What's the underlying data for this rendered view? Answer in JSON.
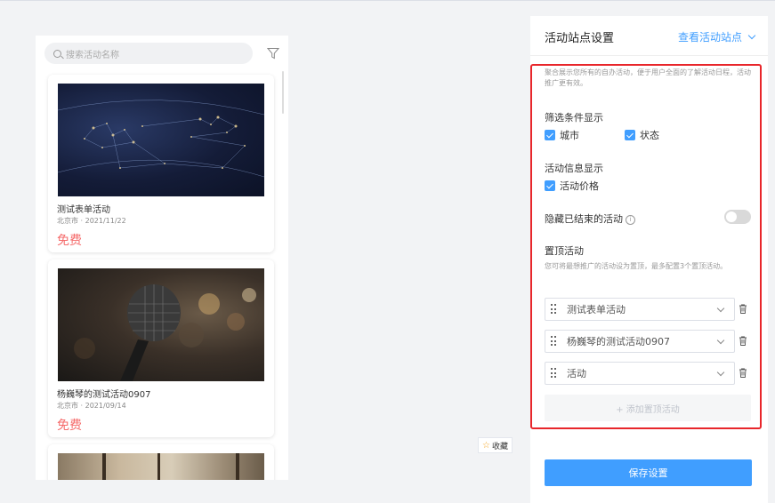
{
  "preview": {
    "search_placeholder": "搜索活动名称",
    "cards": [
      {
        "title": "测试表单活动",
        "meta": "北京市 · 2021/11/22",
        "price": "免费"
      },
      {
        "title": "杨巍琴的测试活动0907",
        "meta": "北京市 · 2021/09/14",
        "price": "免费"
      }
    ]
  },
  "favorite": {
    "label": "收藏"
  },
  "settings": {
    "title": "活动站点设置",
    "view_link": "查看活动站点",
    "description": "聚合展示您所有的自办活动，便于用户全面的了解活动日程，活动推广更有效。",
    "filter_section": {
      "label": "筛选条件显示",
      "options": [
        "城市",
        "状态"
      ]
    },
    "info_section": {
      "label": "活动信息显示",
      "options": [
        "活动价格"
      ]
    },
    "hide_ended": {
      "label": "隐藏已结束的活动",
      "enabled": false
    },
    "pin_section": {
      "label": "置顶活动",
      "description": "您可将最想推广的活动设为置顶，最多配置3个置顶活动。",
      "items": [
        "测试表单活动",
        "杨巍琴的测试活动0907",
        "活动"
      ],
      "add_label": "+ 添加置顶活动"
    },
    "save_label": "保存设置"
  },
  "colors": {
    "accent": "#409eff",
    "price": "#f56c6c",
    "highlight": "#e8262b"
  }
}
